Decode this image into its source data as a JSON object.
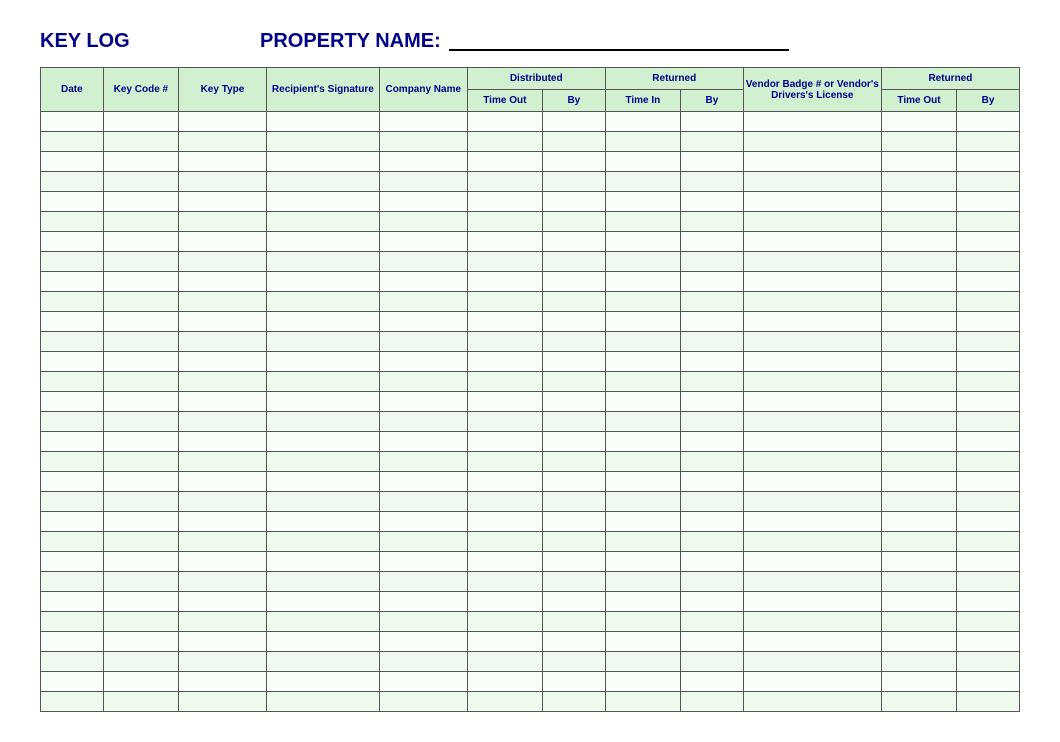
{
  "header": {
    "title": "KEY LOG",
    "property_label": "PROPERTY NAME:"
  },
  "table": {
    "columns": {
      "date": "Date",
      "key_code": "Key Code #",
      "key_type": "Key Type",
      "recipient": "Recipient's Signature",
      "company": "Company Name",
      "distributed": "Distributed",
      "dist_timeout": "Time Out",
      "dist_by": "By",
      "returned": "Returned",
      "ret_timein": "Time In",
      "ret_by": "By",
      "vendor": "Vendor Badge # or Vendor's Drivers's License",
      "ret2": "Returned",
      "ret2_timeout": "Time Out",
      "ret2_by": "By"
    },
    "row_count": 30
  }
}
